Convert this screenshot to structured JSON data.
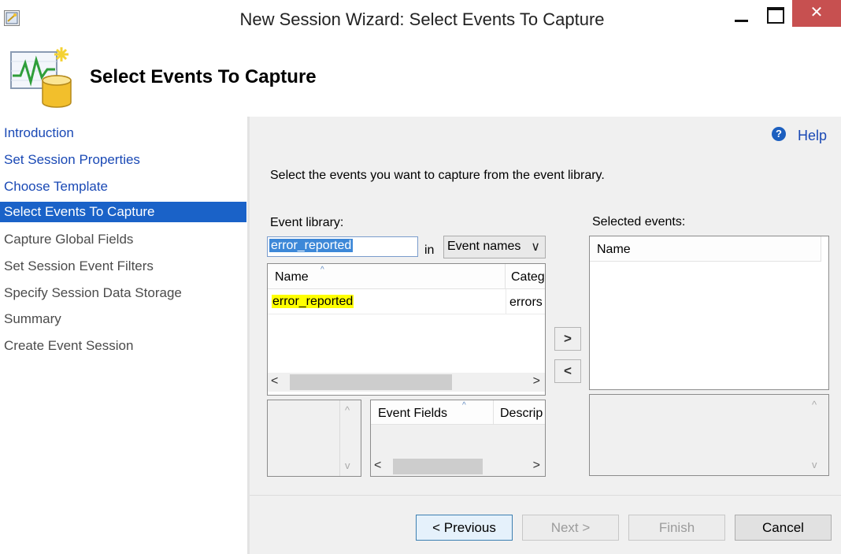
{
  "window": {
    "title": "New Session Wizard: Select Events To Capture",
    "close_glyph": "✕"
  },
  "banner": {
    "title": "Select Events To Capture",
    "icon": "chart-database-icon"
  },
  "nav": {
    "items": [
      {
        "label": "Introduction",
        "state": "link"
      },
      {
        "label": "Set Session Properties",
        "state": "link"
      },
      {
        "label": "Choose Template",
        "state": "link"
      },
      {
        "label": "Select Events To Capture",
        "state": "selected"
      },
      {
        "label": "Capture Global Fields",
        "state": "future"
      },
      {
        "label": "Set Session Event Filters",
        "state": "future"
      },
      {
        "label": "Specify Session Data Storage",
        "state": "future"
      },
      {
        "label": "Summary",
        "state": "future"
      },
      {
        "label": "Create Event Session",
        "state": "future"
      }
    ]
  },
  "help": {
    "label": "Help",
    "icon_glyph": "?"
  },
  "main": {
    "instruction": "Select the events you want to capture from the event library.",
    "library_label": "Event library:",
    "selected_label": "Selected events:",
    "search_value": "error_reported",
    "in_label": "in",
    "search_scope": "Event names",
    "scope_glyph": "∨",
    "library_columns": [
      "Name",
      "Categ"
    ],
    "library_rows": [
      {
        "name": "error_reported",
        "category": "errors"
      }
    ],
    "fields_columns": [
      "Event Fields",
      "Descrip"
    ],
    "selected_columns": [
      "Name"
    ],
    "move_right_glyph": ">",
    "move_left_glyph": "<",
    "scroll_left_glyph": "<",
    "scroll_right_glyph": ">",
    "scroll_up_glyph": "^",
    "scroll_down_glyph": "v",
    "sort_glyph": "^"
  },
  "footer": {
    "previous_label": "< Previous",
    "next_label": "Next >",
    "finish_label": "Finish",
    "cancel_label": "Cancel"
  }
}
